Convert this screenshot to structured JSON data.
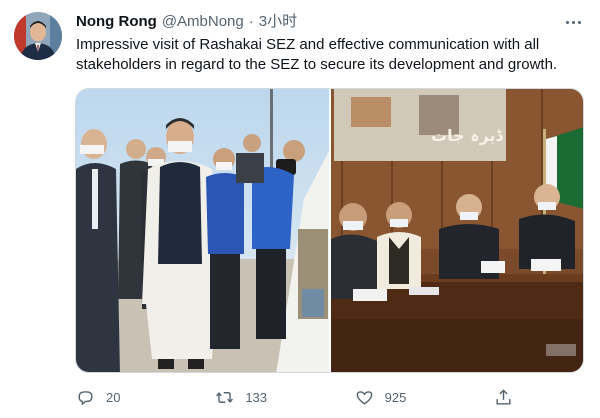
{
  "tweet": {
    "display_name": "Nong Rong",
    "handle": "@AmbNong",
    "separator": "·",
    "timestamp": "3小时",
    "text": "Impressive visit of Rashakai SEZ and effective communication with all stakeholders in regard to the SEZ to secure its development and growth.",
    "more_icon": "more-horizontal-icon"
  },
  "media": {
    "photo_1": {
      "subject": "site-visit-group-photo"
    },
    "photo_2": {
      "subject": "meeting-room-photo",
      "banner_text": "ڈیرہ جات"
    }
  },
  "actions": {
    "reply_count": "20",
    "retweet_count": "133",
    "like_count": "925",
    "icons": [
      "reply-icon",
      "retweet-icon",
      "like-icon",
      "share-icon"
    ]
  },
  "colors": {
    "text_primary": "#0f1419",
    "text_secondary": "#536471",
    "border": "#cfd9de"
  }
}
